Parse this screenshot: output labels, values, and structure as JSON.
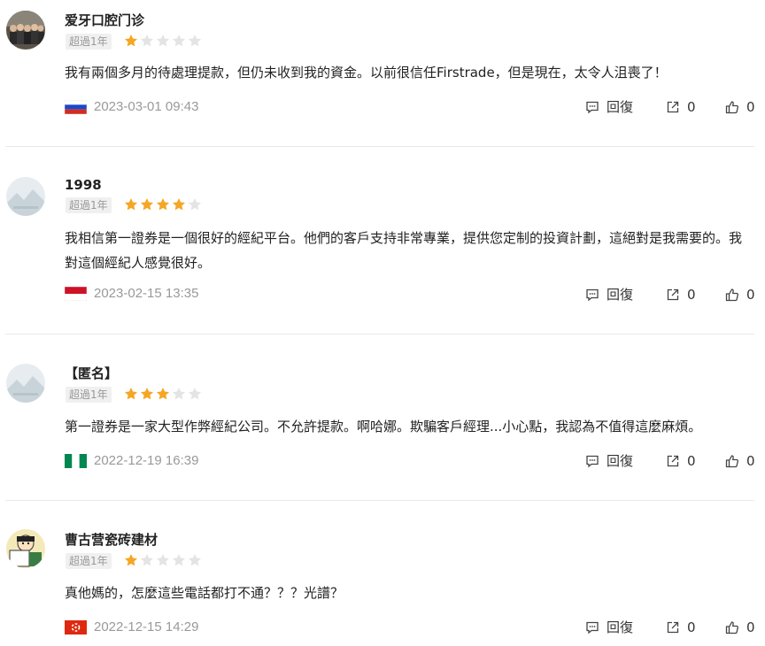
{
  "reviews": [
    {
      "name": "爱牙口腔门诊",
      "tenure": "超過1年",
      "rating": 1,
      "content": "我有兩個多月的待處理提款，但仍未收到我的資金。以前很信任Firstrade，但是現在，太令人沮喪了！",
      "date": "2023-03-01 09:43",
      "flag": "russia",
      "reply_label": "回復",
      "share_count": "0",
      "like_count": "0"
    },
    {
      "name": "1998",
      "tenure": "超過1年",
      "rating": 4,
      "content": "我相信第一證券是一個很好的經紀平台。他們的客戶支持非常專業，提供您定制的投資計劃，這絕對是我需要的。我對這個經紀人感覺很好。",
      "date": "2023-02-15 13:35",
      "flag": "indonesia",
      "reply_label": "回復",
      "share_count": "0",
      "like_count": "0"
    },
    {
      "name": "【匿名】",
      "tenure": "超過1年",
      "rating": 3,
      "content": "第一證券是一家大型作弊經紀公司。不允許提款。啊哈娜。欺騙客戶經理...小心點，我認為不值得這麼麻煩。",
      "date": "2022-12-19 16:39",
      "flag": "nigeria",
      "reply_label": "回復",
      "share_count": "0",
      "like_count": "0"
    },
    {
      "name": "曹古营瓷砖建材",
      "tenure": "超過1年",
      "rating": 1,
      "content": "真他媽的，怎麼這些電話都打不通？？？光譜？",
      "date": "2022-12-15 14:29",
      "flag": "hong-kong",
      "reply_label": "回復",
      "share_count": "0",
      "like_count": "0"
    }
  ],
  "colors": {
    "star_filled": "#f5a623",
    "star_empty": "#e4e4e4",
    "muted_text": "#999999",
    "divider": "#e8e8e8"
  },
  "icons": {
    "reply": "comment-icon",
    "share": "share-icon",
    "like": "thumbs-up-icon"
  }
}
